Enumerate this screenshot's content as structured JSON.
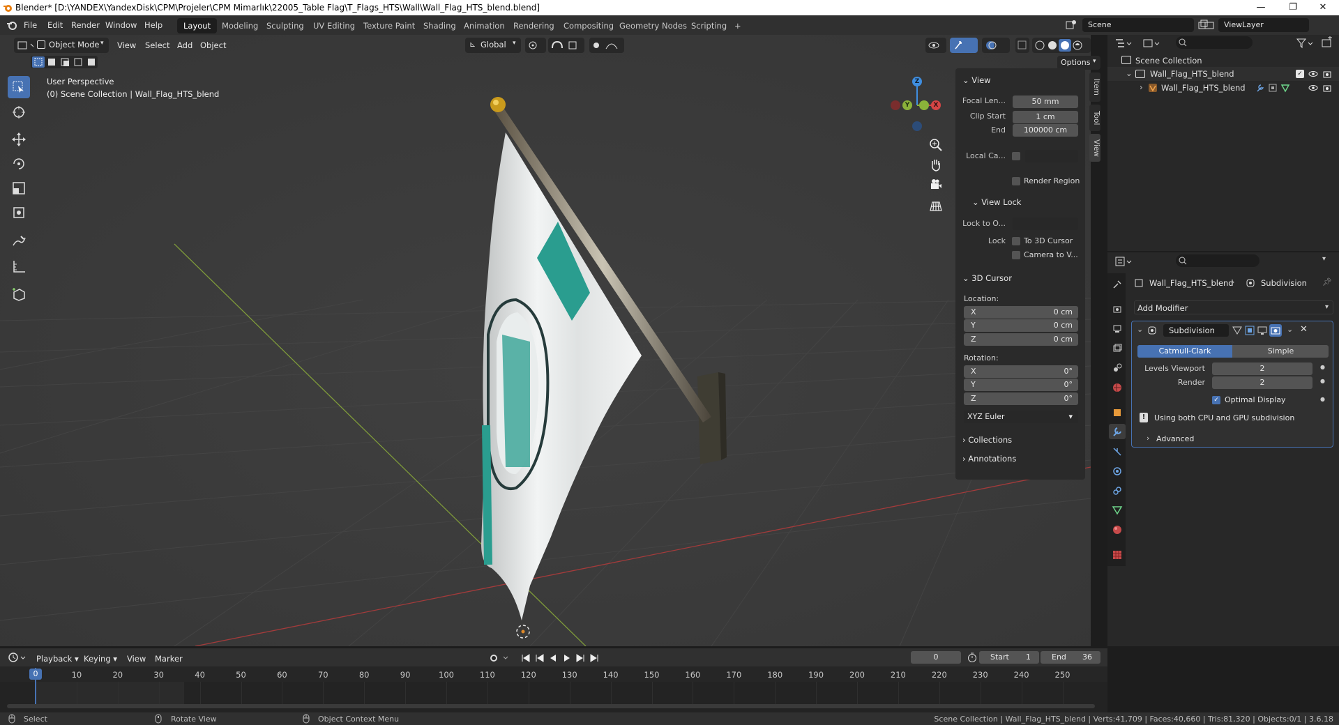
{
  "window": {
    "title": "Blender* [D:\\YANDEX\\YandexDisk\\CPM\\Projeler\\CPM Mimarlık\\22005_Table Flag\\T_Flags_HTS\\Wall\\Wall_Flag_HTS_blend.blend]",
    "controls": [
      "—",
      "❐",
      "✕"
    ]
  },
  "menus": [
    "File",
    "Edit",
    "Render",
    "Window",
    "Help"
  ],
  "workspaces": [
    "Layout",
    "Modeling",
    "Sculpting",
    "UV Editing",
    "Texture Paint",
    "Shading",
    "Animation",
    "Rendering",
    "Compositing",
    "Geometry Nodes",
    "Scripting",
    "+"
  ],
  "active_workspace": "Layout",
  "scene": {
    "name": "Scene",
    "view_layer": "ViewLayer"
  },
  "viewport_header": {
    "mode": "Object Mode",
    "menus": [
      "View",
      "Select",
      "Add",
      "Object"
    ],
    "orientation": "Global",
    "options": "Options"
  },
  "viewport_info": {
    "perspective": "User Perspective",
    "collection": "(0) Scene Collection | Wall_Flag_HTS_blend"
  },
  "gizmo": {
    "x": "X",
    "y": "Y",
    "z": "Z"
  },
  "npanel": {
    "tabs": [
      "Item",
      "Tool",
      "View"
    ],
    "view": {
      "header": "View",
      "focal_label": "Focal Len...",
      "focal_value": "50 mm",
      "clip_start_label": "Clip Start",
      "clip_start_value": "1 cm",
      "clip_end_label": "End",
      "clip_end_value": "100000 cm",
      "local_camera_label": "Local Ca...",
      "render_region": "Render Region"
    },
    "view_lock": {
      "header": "View Lock",
      "lock_to_label": "Lock to O...",
      "lock_label": "Lock",
      "to_3d_cursor": "To 3D Cursor",
      "camera_to_view": "Camera to V..."
    },
    "cursor": {
      "header": "3D Cursor",
      "location_label": "Location:",
      "location": [
        {
          "axis": "X",
          "value": "0 cm"
        },
        {
          "axis": "Y",
          "value": "0 cm"
        },
        {
          "axis": "Z",
          "value": "0 cm"
        }
      ],
      "rotation_label": "Rotation:",
      "rotation": [
        {
          "axis": "X",
          "value": "0°"
        },
        {
          "axis": "Y",
          "value": "0°"
        },
        {
          "axis": "Z",
          "value": "0°"
        }
      ],
      "rotation_mode": "XYZ Euler"
    },
    "collections": "Collections",
    "annotations": "Annotations"
  },
  "outliner": {
    "root": "Scene Collection",
    "items": [
      {
        "name": "Wall_Flag_HTS_blend",
        "type": "collection"
      },
      {
        "name": "Wall_Flag_HTS_blend",
        "type": "object"
      }
    ]
  },
  "properties": {
    "breadcrumb_object": "Wall_Flag_HTS_blend",
    "breadcrumb_modifier": "Subdivision",
    "add_modifier": "Add Modifier",
    "modifier": {
      "name": "Subdivision",
      "type_options": [
        "Catmull-Clark",
        "Simple"
      ],
      "active_type": "Catmull-Clark",
      "levels_viewport_label": "Levels Viewport",
      "levels_viewport": "2",
      "render_label": "Render",
      "render": "2",
      "optimal_display": "Optimal Display",
      "info": "Using both CPU and GPU subdivision",
      "advanced": "Advanced"
    }
  },
  "timeline": {
    "menus": [
      "Playback",
      "Keying",
      "View",
      "Marker"
    ],
    "current_frame": "0",
    "start_label": "Start",
    "start": "1",
    "end_label": "End",
    "end": "36",
    "ticks": [
      "0",
      "10",
      "20",
      "30",
      "40",
      "50",
      "60",
      "70",
      "80",
      "90",
      "100",
      "110",
      "120",
      "130",
      "140",
      "150",
      "160",
      "170",
      "180",
      "190",
      "200",
      "210",
      "220",
      "230",
      "240",
      "250"
    ]
  },
  "statusbar": {
    "select": "Select",
    "rotate": "Rotate View",
    "context": "Object Context Menu",
    "stats": "Scene Collection | Wall_Flag_HTS_blend | Verts:41,709 | Faces:40,660 | Tris:81,320 | Objects:0/1 | 3.6.18"
  },
  "colors": {
    "accent": "#4772b3",
    "flag_green": "#2a9d8f",
    "x_axis": "#d64545",
    "y_axis": "#8bb23a",
    "z_axis": "#3f8ee0"
  }
}
